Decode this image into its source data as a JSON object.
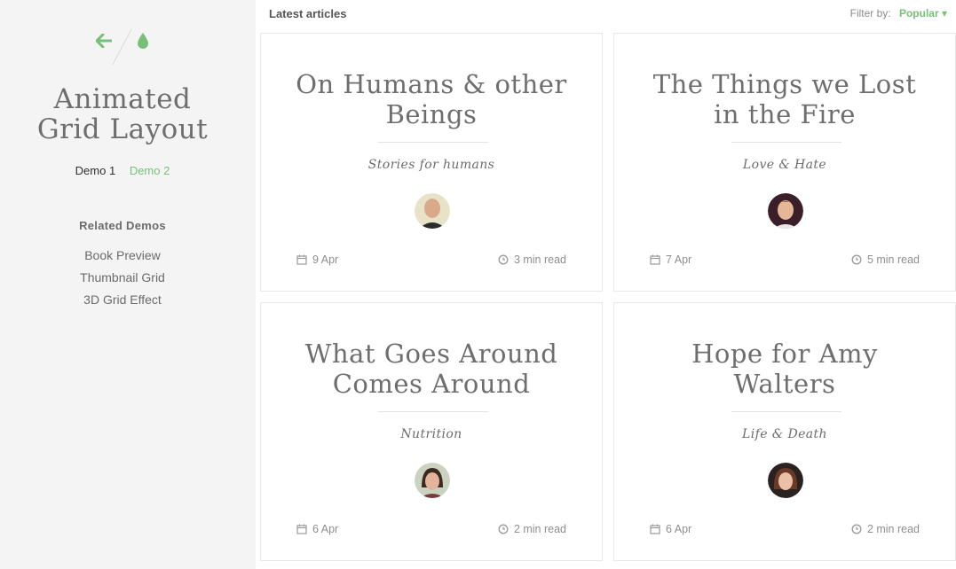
{
  "sidebar": {
    "title_line1": "Animated",
    "title_line2": "Grid Layout",
    "demos": [
      "Demo 1",
      "Demo 2"
    ],
    "related_title": "Related Demos",
    "related_links": [
      "Book Preview",
      "Thumbnail Grid",
      "3D Grid Effect"
    ]
  },
  "header": {
    "latest": "Latest articles",
    "filter_label": "Filter by:",
    "filter_value": "Popular ▾"
  },
  "articles": [
    {
      "title_line1": "On Humans & other",
      "title_line2": "Beings",
      "category": "Stories for humans",
      "date": "9 Apr",
      "read": "3 min read"
    },
    {
      "title_line1": "The Things we Lost",
      "title_line2": "in the Fire",
      "category": "Love & Hate",
      "date": "7 Apr",
      "read": "5 min read"
    },
    {
      "title_line1": "What Goes Around",
      "title_line2": "Comes Around",
      "category": "Nutrition",
      "date": "6 Apr",
      "read": "2 min read"
    },
    {
      "title_line1": "Hope for Amy",
      "title_line2": "Walters",
      "category": "Life & Death",
      "date": "6 Apr",
      "read": "2 min read"
    }
  ],
  "colors": {
    "accent": "#78c078",
    "sidebar_bg": "#f4f4f4",
    "text": "#6e6e6e"
  },
  "icons": [
    "back-arrow-icon",
    "droplet-icon",
    "calendar-icon",
    "clock-icon"
  ]
}
